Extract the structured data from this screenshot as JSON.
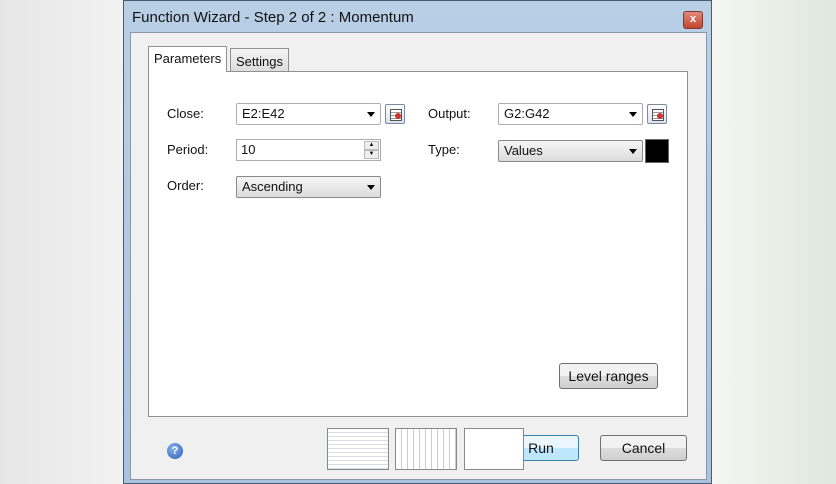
{
  "window": {
    "title": "Function Wizard - Step 2 of 2 : Momentum",
    "close": "x"
  },
  "tabs": [
    {
      "label": "Parameters",
      "active": true
    },
    {
      "label": "Settings",
      "active": false
    }
  ],
  "params": {
    "close_label": "Close:",
    "close_value": "E2:E42",
    "period_label": "Period:",
    "period_value": "10",
    "order_label": "Order:",
    "order_value": "Ascending",
    "output_label": "Output:",
    "output_value": "G2:G42",
    "type_label": "Type:",
    "type_value": "Values",
    "type_color": "#000000",
    "level_ranges": "Level ranges"
  },
  "footer": {
    "help": "?",
    "run": "Run",
    "cancel": "Cancel"
  }
}
